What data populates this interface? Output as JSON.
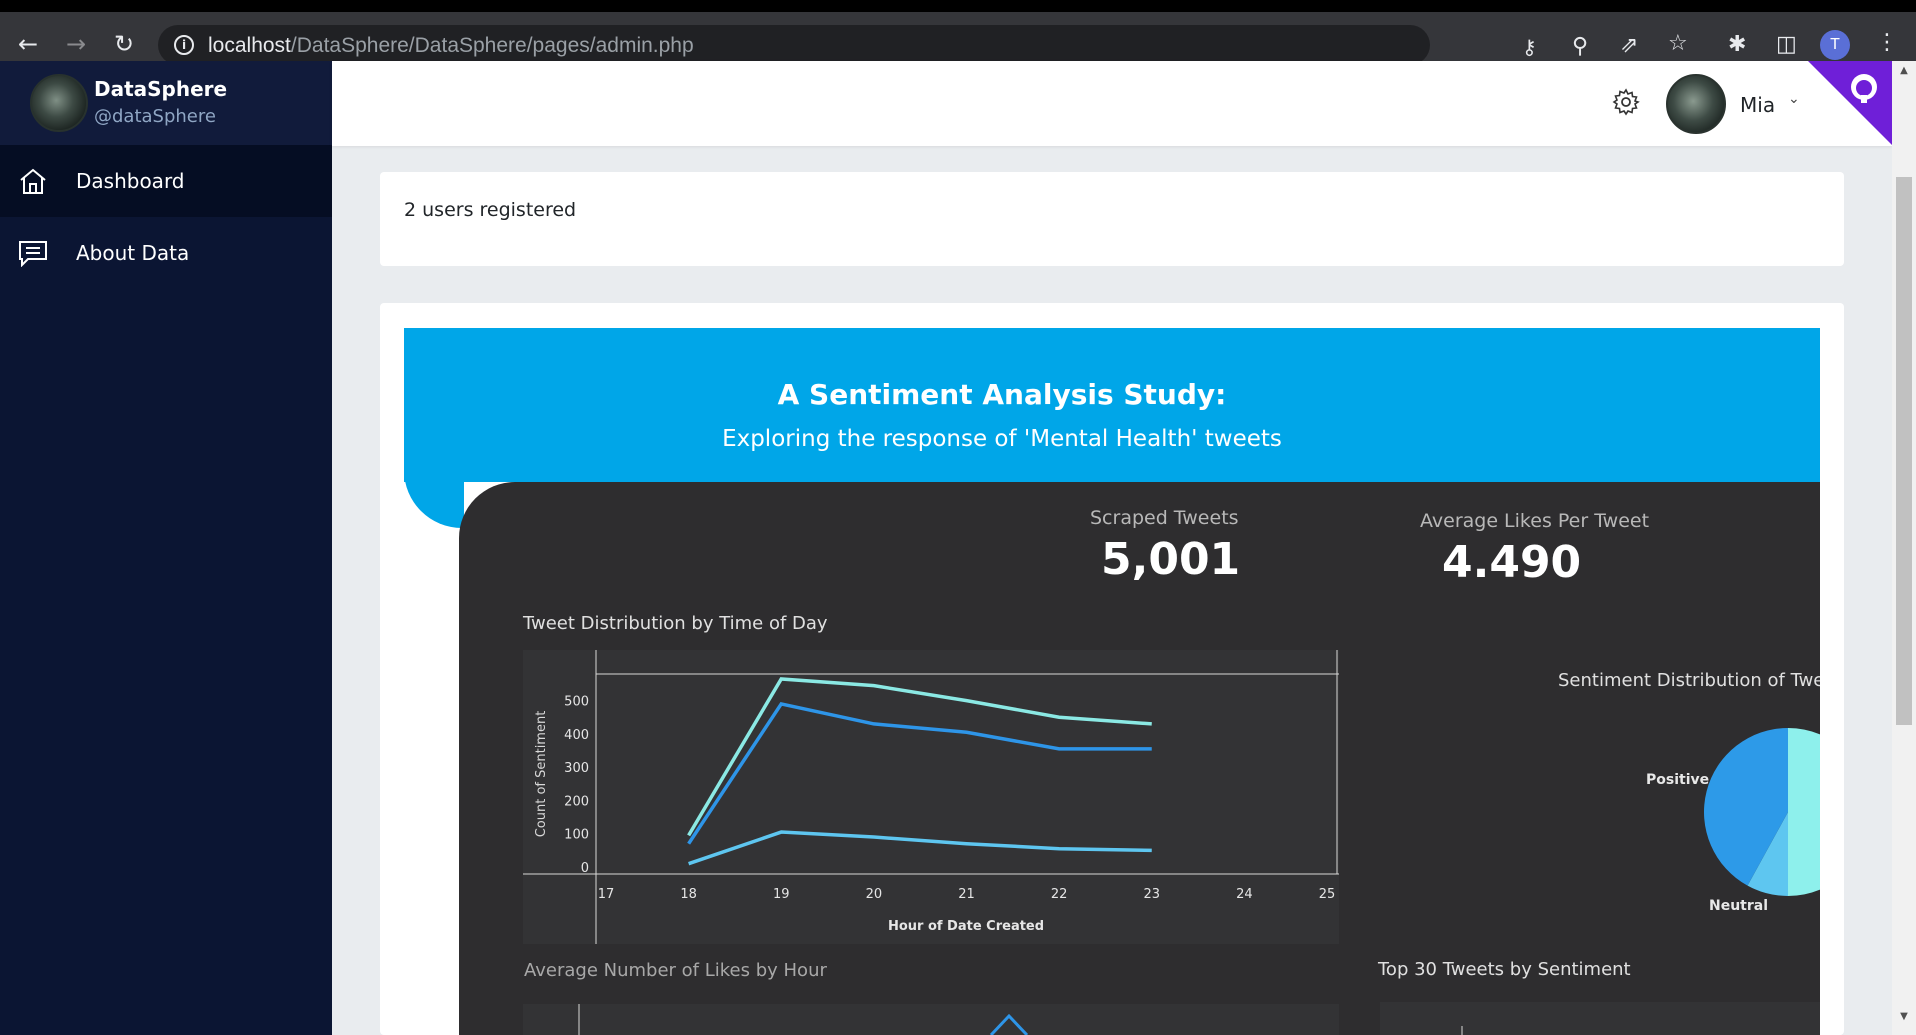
{
  "browser": {
    "url_host": "localhost",
    "url_path": "/DataSphere/DataSphere/pages/admin.php",
    "profile_initial": "T"
  },
  "sidebar": {
    "brand_name": "DataSphere",
    "brand_handle": "@dataSphere",
    "items": [
      {
        "label": "Dashboard",
        "icon": "home-icon",
        "active": true
      },
      {
        "label": "About Data",
        "icon": "message-icon",
        "active": false
      }
    ]
  },
  "header": {
    "user_name": "Mia"
  },
  "stats": {
    "users_registered": "2 users registered"
  },
  "dashboard": {
    "title": "A Sentiment Analysis Study:",
    "subtitle": "Exploring the response of 'Mental Health' tweets",
    "kpis": [
      {
        "label": "Scraped Tweets",
        "value": "5,001"
      },
      {
        "label": "Average Likes Per Tweet",
        "value": "4.490"
      }
    ],
    "panels": {
      "time_of_day": "Tweet Distribution by Time of Day",
      "sentiment_distribution": "Sentiment Distribution of Twee",
      "likes_by_hour": "Average Number of Likes by Hour",
      "top_tweets": "Top 30 Tweets by Sentiment"
    }
  },
  "colors": {
    "sidebar_bg": "#0b1533",
    "header_blue": "#00a6e8",
    "dark_panel": "#2e2d2f",
    "github_corner": "#6f1fd8"
  },
  "chart_data": [
    {
      "type": "line",
      "title": "Tweet Distribution by Time of Day",
      "xlabel": "Hour of Date Created",
      "ylabel": "Count of Sentiment",
      "x_ticks": [
        "17",
        "18",
        "19",
        "20",
        "21",
        "22",
        "23",
        "24",
        "25"
      ],
      "y_ticks": [
        "0",
        "100",
        "200",
        "300",
        "400",
        "500"
      ],
      "xlim": [
        17,
        25
      ],
      "ylim": [
        0,
        580
      ],
      "x": [
        18,
        19,
        20,
        21,
        22,
        23
      ],
      "series": [
        {
          "color": "#8be9e4",
          "values": [
            95,
            565,
            545,
            500,
            450,
            430
          ]
        },
        {
          "color": "#2e95e8",
          "values": [
            70,
            490,
            430,
            405,
            355,
            355
          ]
        },
        {
          "color": "#5ec6f0",
          "values": [
            10,
            105,
            90,
            70,
            55,
            50
          ]
        }
      ]
    },
    {
      "type": "pie",
      "title": "Sentiment Distribution of Twee",
      "slices": [
        {
          "label": "Positive",
          "color": "#2d9ae8",
          "value": 42
        },
        {
          "label": "Neutral",
          "color": "#5ec6f0",
          "value": 8
        },
        {
          "label": "",
          "color": "#8ef0ec",
          "value": 50
        }
      ]
    }
  ]
}
